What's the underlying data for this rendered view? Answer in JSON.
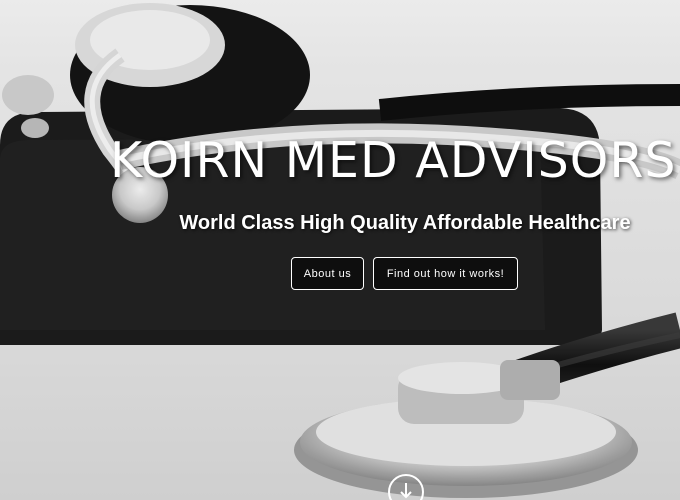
{
  "hero": {
    "title": "KOIRN MED ADVISORS",
    "tagline": "World Class High Quality Affordable Healthcare",
    "buttons": {
      "about_label": "About us",
      "how_label": "Find out how it works!"
    },
    "scroll_icon": "arrow-down-circle-icon",
    "background_image": "stethoscope-photo"
  },
  "colors": {
    "text": "#ffffff",
    "button_background": "#1a1a1a",
    "button_border": "#ffffff"
  }
}
